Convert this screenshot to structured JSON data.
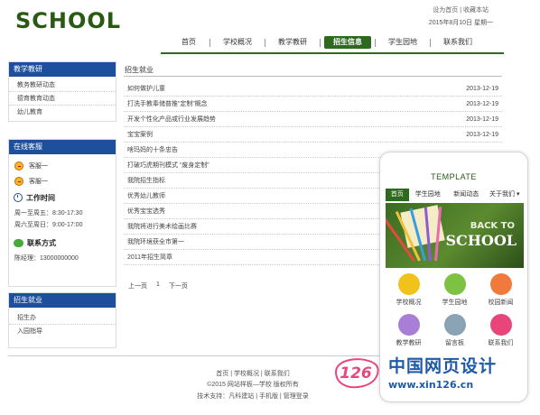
{
  "header": {
    "logo": "SCHOOL",
    "links": "设为首页 | 收藏本站",
    "date": "2015年8月10日 星期一"
  },
  "nav": [
    {
      "label": "首页",
      "active": false
    },
    {
      "label": "学校概况",
      "active": false
    },
    {
      "label": "教学教研",
      "active": false
    },
    {
      "label": "招生信息",
      "active": true
    },
    {
      "label": "学生园地",
      "active": false
    },
    {
      "label": "联系我们",
      "active": false
    }
  ],
  "sidebar": {
    "teaching": {
      "title": "教学教研",
      "items": [
        "教务教研动态",
        "德育教育动态",
        "幼儿教育"
      ]
    },
    "service": {
      "title": "在线客服",
      "agents": [
        "客服一",
        "客服一"
      ],
      "hours_title": "工作时间",
      "hours": [
        "周一至周五：8:30-17:30",
        "周六至周日：9:00-17:00"
      ],
      "contact_title": "联系方式",
      "contact": "陈经理：13000000000"
    },
    "admissions": {
      "title": "招生就业",
      "items": [
        "招生办",
        "入园指导"
      ]
    }
  },
  "main": {
    "title": "招生就业",
    "news": [
      {
        "title": "如何做护儿童",
        "date": "2013-12-19"
      },
      {
        "title": "打洗手教奉储普推“定制”概念",
        "date": "2013-12-19"
      },
      {
        "title": "开发个性化产品或行业发展趋势",
        "date": "2013-12-19"
      },
      {
        "title": "宝宝案例",
        "date": "2013-12-19"
      },
      {
        "title": "啥玛妈的十条忠告",
        "date": ""
      },
      {
        "title": "打破巧虎期刊模式 “废身定制”",
        "date": ""
      },
      {
        "title": "我院招生指标",
        "date": ""
      },
      {
        "title": "优秀幼儿教师",
        "date": ""
      },
      {
        "title": "优秀宝宝选秀",
        "date": ""
      },
      {
        "title": "我院将进行美术绘画比赛",
        "date": ""
      },
      {
        "title": "我院环境获全市第一",
        "date": ""
      },
      {
        "title": "2011年招生简章",
        "date": ""
      }
    ],
    "pager": {
      "prev": "上一页",
      "page": "1",
      "next": "下一页"
    }
  },
  "footer": {
    "links": "首页 | 学校概况 | 联系我们",
    "copyright": "©2015 网站样板—学校 版权所有",
    "support": "技术支持：凡科建站 | 手机版 | 管理登录"
  },
  "phone": {
    "title": "TEMPLATE",
    "nav": [
      {
        "label": "首页",
        "active": true
      },
      {
        "label": "学生园地",
        "active": false
      },
      {
        "label": "新闻动态",
        "active": false
      },
      {
        "label": "关于我们 ▾",
        "active": false
      }
    ],
    "banner_line1": "BACK TO",
    "banner_line2": "SCHOOL",
    "apps": [
      {
        "label": "学校概况",
        "color": "#f1c21b"
      },
      {
        "label": "学生园地",
        "color": "#7dc242"
      },
      {
        "label": "校园新闻",
        "color": "#f07a3c"
      },
      {
        "label": "教学教研",
        "color": "#a87ed6"
      },
      {
        "label": "留言板",
        "color": "#8aa3b5"
      },
      {
        "label": "联系我们",
        "color": "#e8457a"
      }
    ]
  },
  "watermark": {
    "badge": "126",
    "text": "中国网页设计",
    "url": "www.xin126.cn"
  }
}
